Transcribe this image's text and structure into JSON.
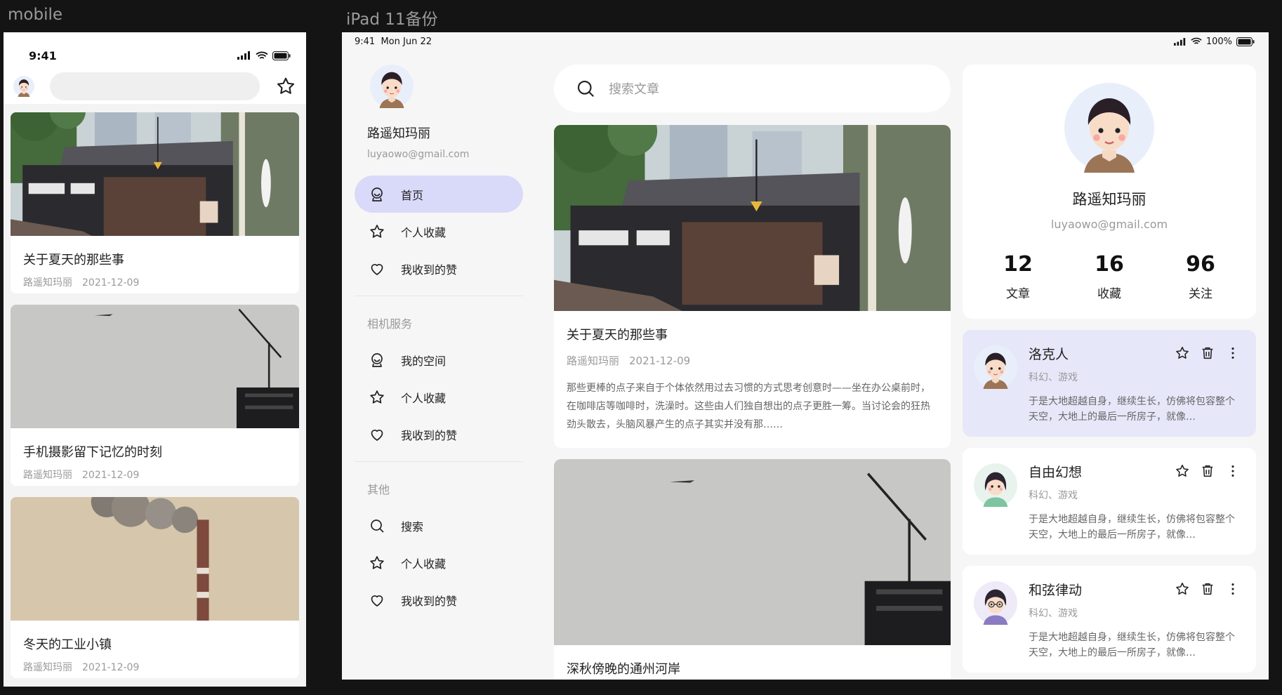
{
  "frames": {
    "mobile_label": "mobile",
    "tablet_label": "iPad 11备份"
  },
  "mobile": {
    "status_time": "9:41",
    "articles": [
      {
        "title": "关于夏天的那些事",
        "author": "路遥知玛丽",
        "date": "2021-12-09",
        "image": "building-photo"
      },
      {
        "title": "手机摄影留下记忆的时刻",
        "author": "路遥知玛丽",
        "date": "2021-12-09",
        "image": "crane-sky-photo"
      },
      {
        "title": "冬天的工业小镇",
        "author": "路遥知玛丽",
        "date": "2021-12-09",
        "image": "chimney-photo"
      }
    ]
  },
  "tablet": {
    "status_time": "9:41",
    "status_date": "Mon Jun 22",
    "battery": "100%",
    "sidebar": {
      "name": "路遥知玛丽",
      "email": "luyaowo@gmail.com",
      "main_items": [
        {
          "label": "首页",
          "icon": "home-icon",
          "active": true
        },
        {
          "label": "个人收藏",
          "icon": "star-icon",
          "active": false
        },
        {
          "label": "我收到的赞",
          "icon": "heart-icon",
          "active": false
        }
      ],
      "section1_title": "相机服务",
      "section1_items": [
        {
          "label": "我的空间",
          "icon": "home-icon"
        },
        {
          "label": "个人收藏",
          "icon": "star-icon"
        },
        {
          "label": "我收到的赞",
          "icon": "heart-icon"
        }
      ],
      "section2_title": "其他",
      "section2_items": [
        {
          "label": "搜索",
          "icon": "search-icon"
        },
        {
          "label": "个人收藏",
          "icon": "star-icon"
        },
        {
          "label": "我收到的赞",
          "icon": "heart-icon"
        }
      ]
    },
    "search_placeholder": "搜索文章",
    "articles": [
      {
        "title": "关于夏天的那些事",
        "author": "路遥知玛丽",
        "date": "2021-12-09",
        "desc": "那些更棒的点子来自于个体依然用过去习惯的方式思考创意时——坐在办公桌前时，在咖啡店等咖啡时，洗澡时。这些由人们独自想出的点子更胜一筹。当讨论会的狂热劲头散去，头脑风暴产生的点子其实并没有那……"
      },
      {
        "title": "深秋傍晚的通州河岸"
      }
    ],
    "profile": {
      "name": "路遥知玛丽",
      "email": "luyaowo@gmail.com",
      "stats": [
        {
          "value": "12",
          "label": "文章"
        },
        {
          "value": "16",
          "label": "收藏"
        },
        {
          "value": "96",
          "label": "关注"
        }
      ]
    },
    "users": [
      {
        "name": "洛克人",
        "tags": "科幻、游戏",
        "desc": "于是大地超越自身，继续生长，仿佛将包容整个天空，大地上的最后一所房子，就像…",
        "active": true
      },
      {
        "name": "自由幻想",
        "tags": "科幻、游戏",
        "desc": "于是大地超越自身，继续生长，仿佛将包容整个天空，大地上的最后一所房子，就像…",
        "active": false
      },
      {
        "name": "和弦律动",
        "tags": "科幻、游戏",
        "desc": "于是大地超越自身，继续生长，仿佛将包容整个天空，大地上的最后一所房子，就像…",
        "active": false
      }
    ]
  },
  "colors": {
    "accent_active": "#d9daf9",
    "card_active": "#e7e7fa",
    "muted_text": "#9a9a9a"
  }
}
